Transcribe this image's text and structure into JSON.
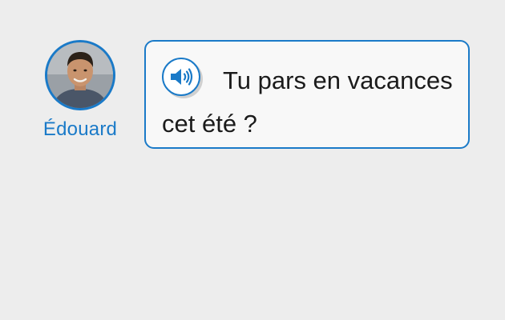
{
  "speaker": {
    "name": "Édouard"
  },
  "bubble": {
    "text": "Tu pars en vacances cet été ?"
  },
  "colors": {
    "accent": "#1a7ac8",
    "background": "#ededed",
    "bubble_background": "#f8f8f8",
    "text": "#1b1b1b"
  },
  "icons": {
    "audio": "speaker-volume-icon",
    "avatar": "user-photo"
  }
}
